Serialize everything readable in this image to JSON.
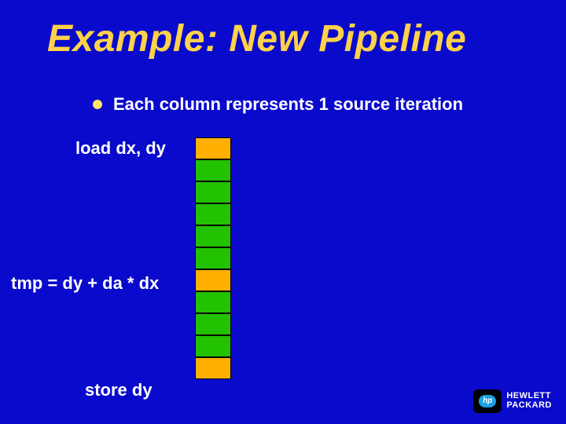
{
  "title": "Example: New Pipeline",
  "bullet": "Each column represents 1 source iteration",
  "labels": {
    "l1": "load dx, dy",
    "l2": "tmp = dy + da * dx",
    "l3": "store dy"
  },
  "logo": {
    "badge": "hp",
    "line1": "HEWLETT",
    "line2": "PACKARD"
  },
  "chart_data": {
    "type": "table",
    "title": "Pipeline column (one source iteration)",
    "rows": 11,
    "highlight_rows": [
      0,
      6,
      10
    ],
    "row_annotations": {
      "0": "load dx, dy",
      "6": "tmp = dy + da * dx",
      "10": "store dy"
    },
    "colors": {
      "default": "#22c200",
      "highlight": "#ffb000"
    }
  }
}
